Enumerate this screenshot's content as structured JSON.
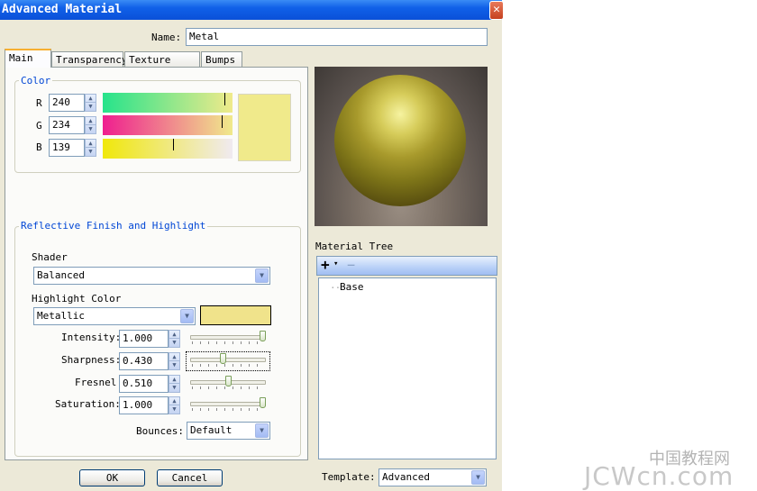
{
  "window": {
    "title": "Advanced Material",
    "close_glyph": "✕"
  },
  "name": {
    "label": "Name:",
    "value": "Metal"
  },
  "tabs": [
    {
      "label": "Main",
      "active": true
    },
    {
      "label": "Transparency",
      "active": false
    },
    {
      "label": "Texture Maps",
      "active": false
    },
    {
      "label": "Bumps",
      "active": false
    }
  ],
  "color": {
    "group_label": "Color",
    "r": {
      "label": "R",
      "value": "240"
    },
    "g": {
      "label": "G",
      "value": "234"
    },
    "b": {
      "label": "B",
      "value": "139"
    },
    "swatch_hex": "#f0ea8b"
  },
  "reflective": {
    "group_label": "Reflective Finish and Highlight",
    "shader_label": "Shader",
    "shader_value": "Balanced",
    "highlight_label": "Highlight Color",
    "highlight_value": "Metallic",
    "highlight_swatch_hex": "#f0e38b",
    "intensity": {
      "label": "Intensity:",
      "value": "1.000",
      "level": 1.0
    },
    "sharpness": {
      "label": "Sharpness:",
      "value": "0.430",
      "level": 0.43
    },
    "fresnel": {
      "label": "Fresnel:",
      "value": "0.510",
      "level": 0.51
    },
    "saturation": {
      "label": "Saturation:",
      "value": "1.000",
      "level": 1.0
    },
    "bounces_label": "Bounces:",
    "bounces_value": "Default"
  },
  "material_tree": {
    "label": "Material Tree",
    "add_glyph": "+",
    "add_dropdown_glyph": "▾",
    "remove_glyph": "−",
    "items": [
      {
        "label": "Base"
      }
    ]
  },
  "footer": {
    "ok_label": "OK",
    "cancel_label": "Cancel",
    "template_label": "Template:",
    "template_value": "Advanced"
  },
  "watermark": {
    "top": "中国教程网",
    "bottom": "JCWcn.com"
  },
  "icons": {
    "spin_up": "▲",
    "spin_down": "▼",
    "dropdown": "▼"
  }
}
